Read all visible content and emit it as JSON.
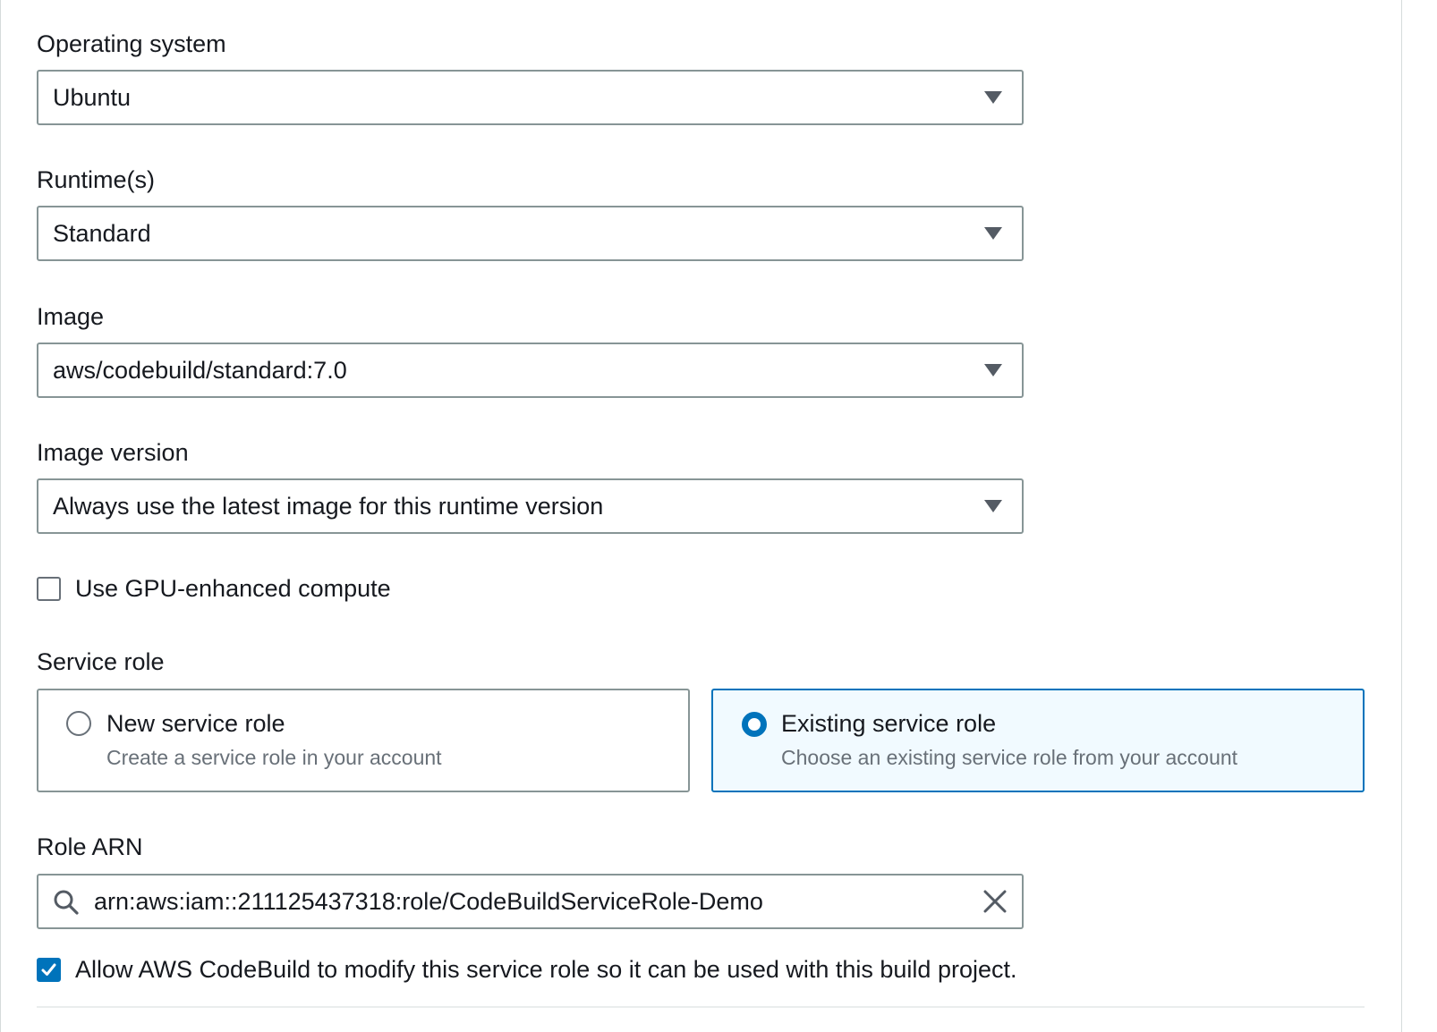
{
  "environment": {
    "operating_system": {
      "label": "Operating system",
      "value": "Ubuntu"
    },
    "runtime": {
      "label": "Runtime(s)",
      "value": "Standard"
    },
    "image": {
      "label": "Image",
      "value": "aws/codebuild/standard:7.0"
    },
    "image_version": {
      "label": "Image version",
      "value": "Always use the latest image for this runtime version"
    },
    "gpu": {
      "label": "Use GPU-enhanced compute",
      "checked": false
    }
  },
  "service_role": {
    "label": "Service role",
    "options": [
      {
        "title": "New service role",
        "description": "Create a service role in your account",
        "selected": false
      },
      {
        "title": "Existing service role",
        "description": "Choose an existing service role from your account",
        "selected": true
      }
    ]
  },
  "role_arn": {
    "label": "Role ARN",
    "value": "arn:aws:iam::211125437318:role/CodeBuildServiceRole-Demo"
  },
  "allow_modify": {
    "label": "Allow AWS CodeBuild to modify this service role so it can be used with this build project.",
    "checked": true
  },
  "icons": {
    "dropdown": "caret-down-icon",
    "search": "search-icon",
    "clear": "close-icon",
    "check": "checkmark-icon"
  },
  "colors": {
    "accent": "#0073bb",
    "selected_tile_bg": "#f1faff",
    "border": "#879596",
    "secondary_text": "#687078"
  }
}
